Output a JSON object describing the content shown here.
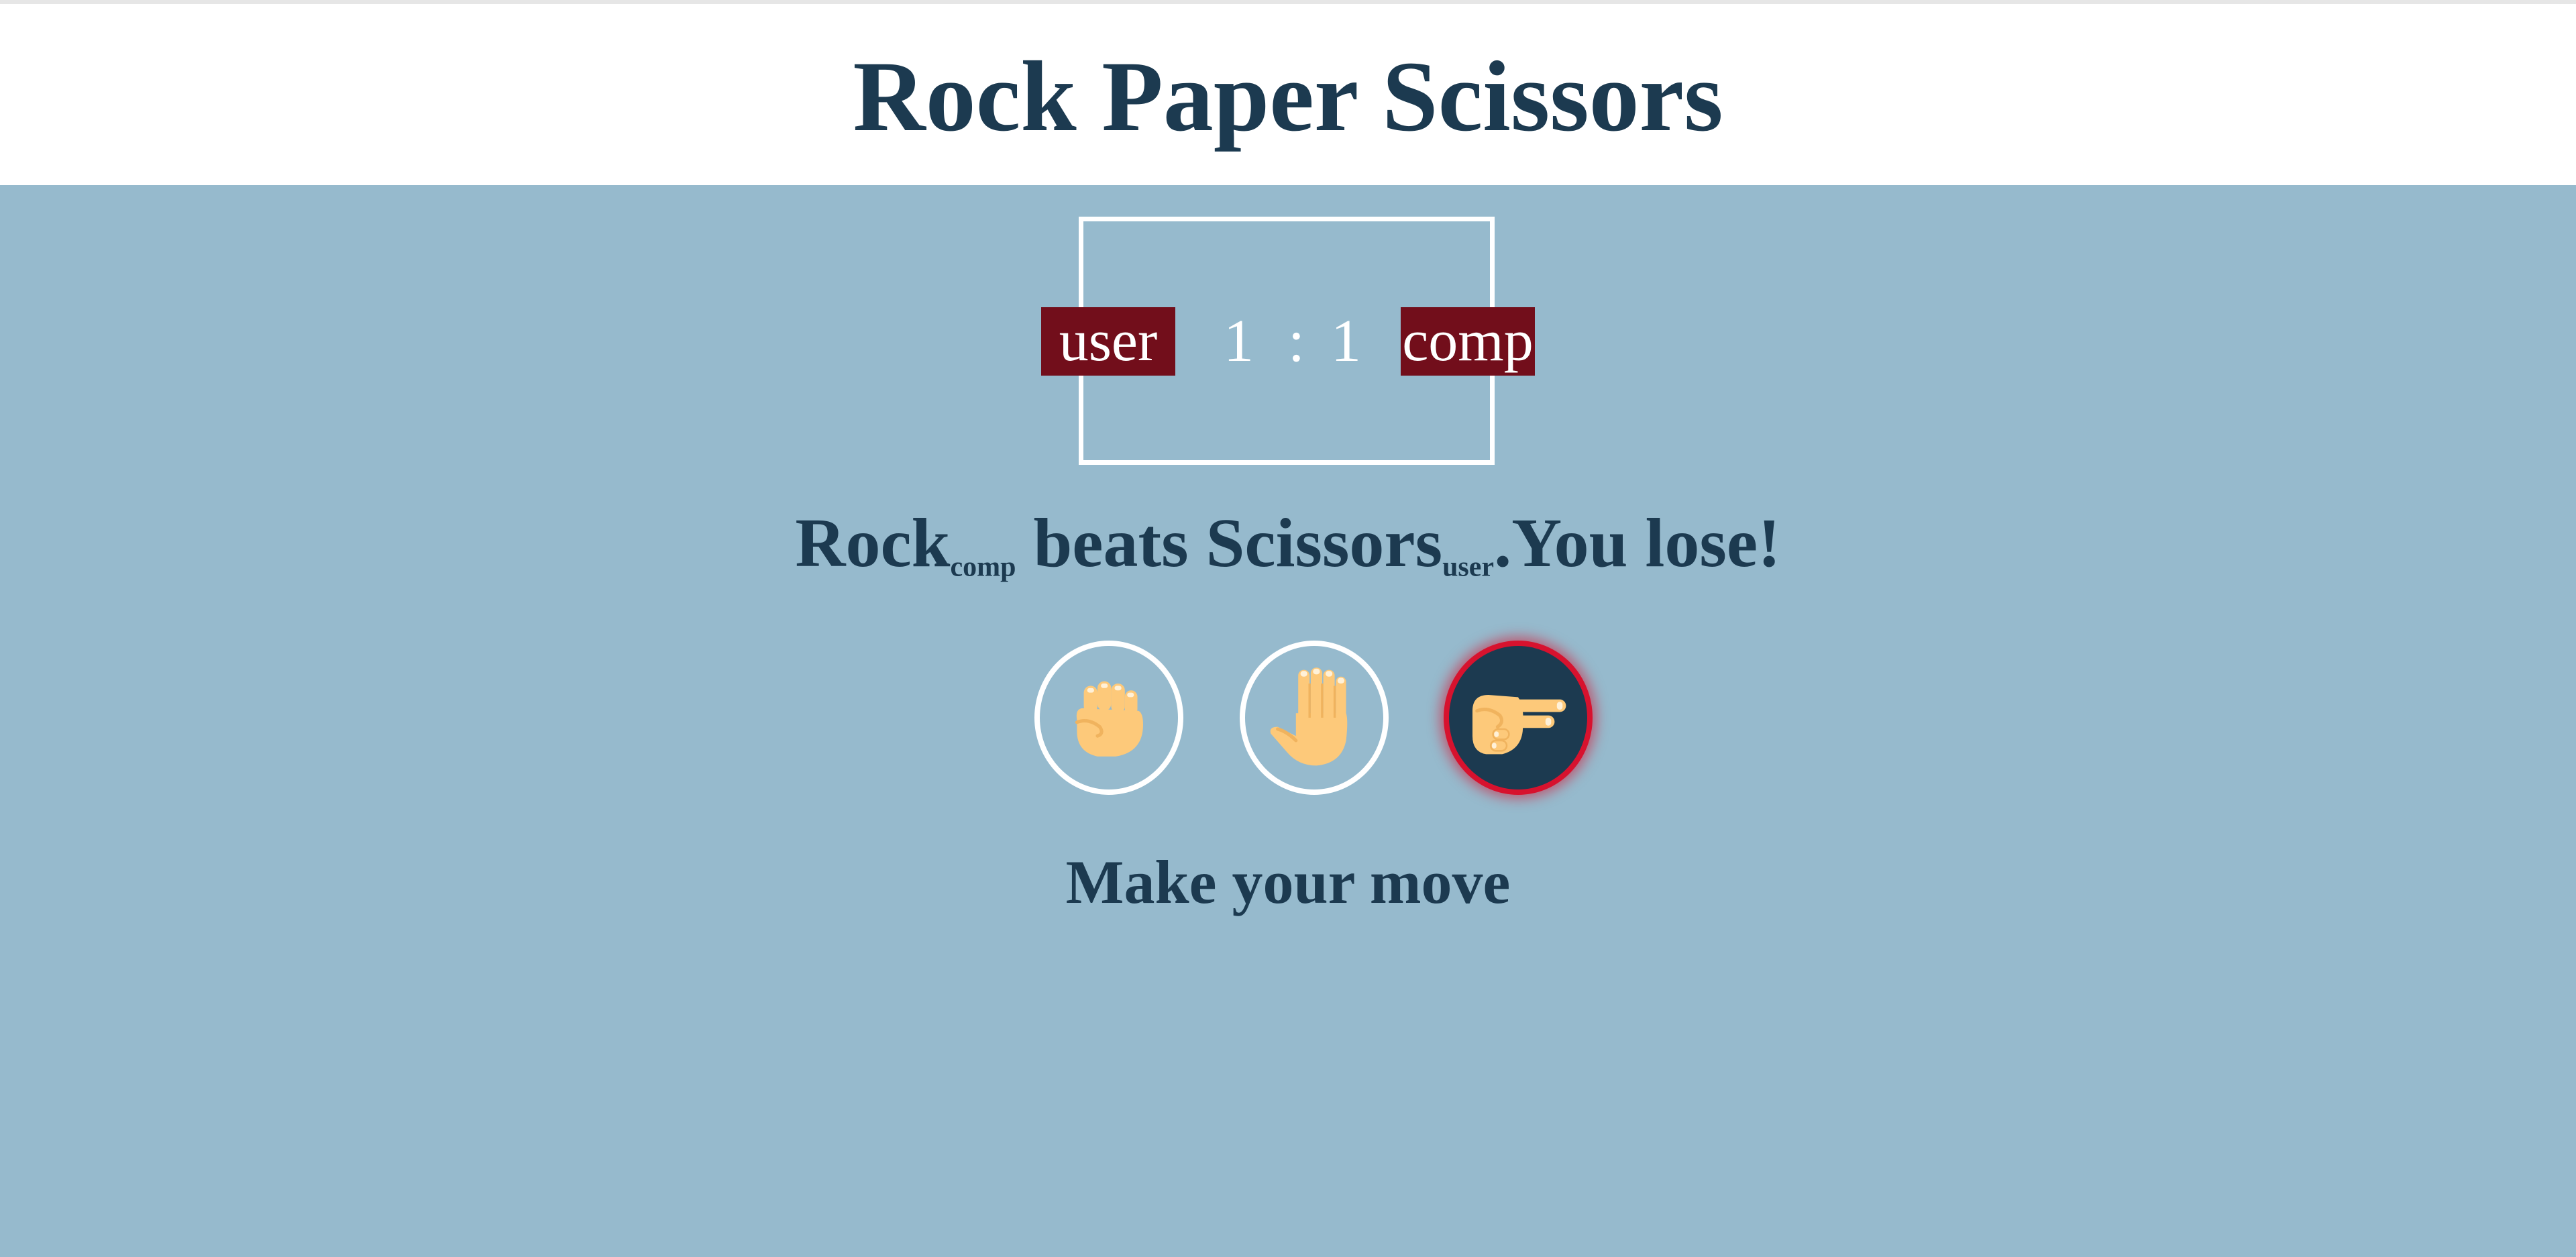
{
  "header": {
    "title": "Rock Paper Scissors"
  },
  "scoreboard": {
    "user_label": "user",
    "comp_label": "comp",
    "user_score": "1",
    "separator": ":",
    "comp_score": "1"
  },
  "result": {
    "comp_move": "Rock",
    "comp_sub": "comp",
    "verb": "beats",
    "user_move": "Scissors",
    "user_sub": "user",
    "outcome": ".You lose!"
  },
  "choices": [
    {
      "name": "rock",
      "icon": "fist-icon",
      "selected": false
    },
    {
      "name": "paper",
      "icon": "open-hand-icon",
      "selected": false
    },
    {
      "name": "scissors",
      "icon": "victory-hand-icon",
      "selected": true
    }
  ],
  "prompt": "Make your move",
  "colors": {
    "background": "#96bacd",
    "header_background": "#ffffff",
    "text": "#1c3a50",
    "badge": "#720e1b",
    "selected_ring": "#d7122e",
    "selected_fill": "#1c3a50",
    "skin": "#fdc97a"
  }
}
